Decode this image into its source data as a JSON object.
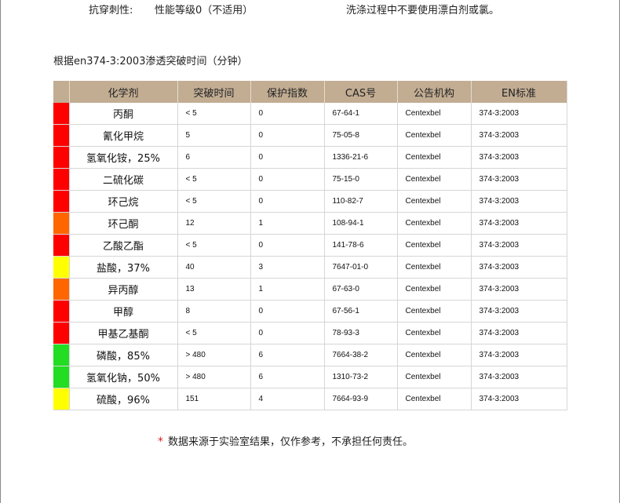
{
  "top": {
    "puncture_label": "抗穿刺性:",
    "puncture_value": "性能等级0（不适用）",
    "wash_note": "洗涤过程中不要使用漂白剂或氯。"
  },
  "section_title": "根据en374-3:2003渗透突破时间（分钟）",
  "table": {
    "headers": [
      "化学剂",
      "突破时间",
      "保护指数",
      "CAS号",
      "公告机构",
      "EN标准"
    ],
    "rows": [
      {
        "color": "#ff0000",
        "name": "丙酮",
        "time": "< 5",
        "index": "0",
        "cas": "67-64-1",
        "body": "Centexbel",
        "en": "374-3:2003"
      },
      {
        "color": "#ff0000",
        "name": "氰化甲烷",
        "time": "5",
        "index": "0",
        "cas": "75-05-8",
        "body": "Centexbel",
        "en": "374-3:2003"
      },
      {
        "color": "#ff0000",
        "name": "氢氧化铵，25%",
        "time": "6",
        "index": "0",
        "cas": "1336-21-6",
        "body": "Centexbel",
        "en": "374-3:2003"
      },
      {
        "color": "#ff0000",
        "name": "二硫化碳",
        "time": "< 5",
        "index": "0",
        "cas": "75-15-0",
        "body": "Centexbel",
        "en": "374-3:2003"
      },
      {
        "color": "#ff0000",
        "name": "环己烷",
        "time": "< 5",
        "index": "0",
        "cas": "110-82-7",
        "body": "Centexbel",
        "en": "374-3:2003"
      },
      {
        "color": "#ff6600",
        "name": "环己酮",
        "time": "12",
        "index": "1",
        "cas": "108-94-1",
        "body": "Centexbel",
        "en": "374-3:2003"
      },
      {
        "color": "#ff0000",
        "name": "乙酸乙酯",
        "time": "< 5",
        "index": "0",
        "cas": "141-78-6",
        "body": "Centexbel",
        "en": "374-3:2003"
      },
      {
        "color": "#ffff00",
        "name": "盐酸，37%",
        "time": "40",
        "index": "3",
        "cas": "7647-01-0",
        "body": "Centexbel",
        "en": "374-3:2003"
      },
      {
        "color": "#ff6600",
        "name": "异丙醇",
        "time": "13",
        "index": "1",
        "cas": "67-63-0",
        "body": "Centexbel",
        "en": "374-3:2003"
      },
      {
        "color": "#ff0000",
        "name": "甲醇",
        "time": "8",
        "index": "0",
        "cas": "67-56-1",
        "body": "Centexbel",
        "en": "374-3:2003"
      },
      {
        "color": "#ff0000",
        "name": "甲基乙基酮",
        "time": "< 5",
        "index": "0",
        "cas": "78-93-3",
        "body": "Centexbel",
        "en": "374-3:2003"
      },
      {
        "color": "#22dd22",
        "name": "磷酸，85%",
        "time": "> 480",
        "index": "6",
        "cas": "7664-38-2",
        "body": "Centexbel",
        "en": "374-3:2003"
      },
      {
        "color": "#22dd22",
        "name": "氢氧化钠，50%",
        "time": "> 480",
        "index": "6",
        "cas": "1310-73-2",
        "body": "Centexbel",
        "en": "374-3:2003"
      },
      {
        "color": "#ffff00",
        "name": "硫酸，96%",
        "time": "151",
        "index": "4",
        "cas": "7664-93-9",
        "body": "Centexbel",
        "en": "374-3:2003"
      }
    ]
  },
  "disclaimer": {
    "star": "*",
    "text": "数据来源于实验室结果，仅作参考，不承担任何责任。"
  }
}
